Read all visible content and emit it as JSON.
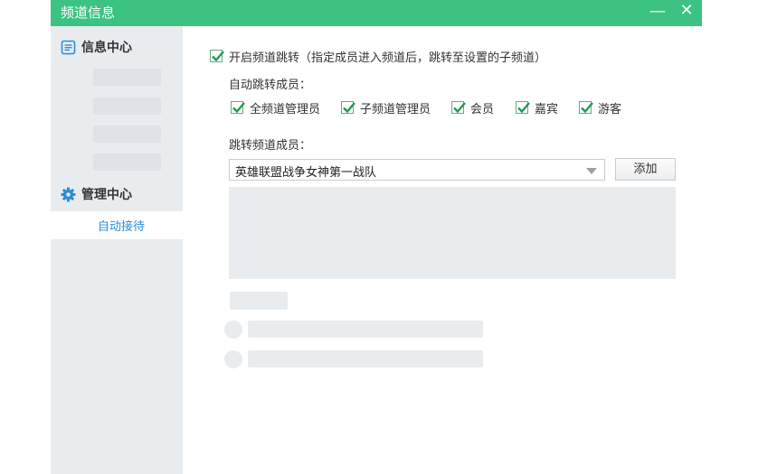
{
  "window": {
    "title": "频道信息",
    "minimize_glyph": "—",
    "close_glyph": "✕",
    "accent_color": "#3cc383"
  },
  "sidebar": {
    "sections": [
      {
        "label": "信息中心",
        "icon": "document-icon"
      },
      {
        "label": "管理中心",
        "icon": "gear-icon"
      }
    ],
    "active_item": "自动接待",
    "active_color": "#2b8dd8"
  },
  "main": {
    "enable_redirect": {
      "checked": true,
      "label": "开启频道跳转（指定成员进入频道后，跳转至设置的子频道）"
    },
    "auto_redirect_members_label": "自动跳转成员：",
    "member_types": [
      {
        "label": "全频道管理员",
        "checked": true
      },
      {
        "label": "子频道管理员",
        "checked": true
      },
      {
        "label": "会员",
        "checked": true
      },
      {
        "label": "嘉宾",
        "checked": true
      },
      {
        "label": "游客",
        "checked": true
      }
    ],
    "redirect_channel_label": "跳转频道成员：",
    "channel_select_value": "英雄联盟战争女神第一战队",
    "add_button_label": "添加"
  }
}
